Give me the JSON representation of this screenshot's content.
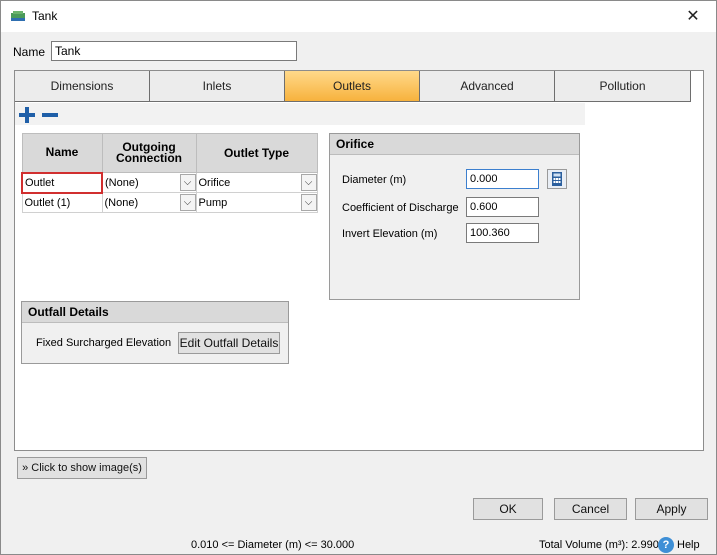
{
  "window": {
    "title": "Tank",
    "close_glyph": "✕",
    "title_icon": "tank-icon"
  },
  "name_field": {
    "label": "Name",
    "value": "Tank"
  },
  "tabs": [
    {
      "label": "Dimensions",
      "active": false
    },
    {
      "label": "Inlets",
      "active": false
    },
    {
      "label": "Outlets",
      "active": true
    },
    {
      "label": "Advanced",
      "active": false
    },
    {
      "label": "Pollution",
      "active": false
    }
  ],
  "toolbar": {
    "add_icon": "plus-icon",
    "remove_icon": "minus-icon"
  },
  "outlets_table": {
    "headers": [
      "Name",
      "Outgoing Connection",
      "Outlet Type"
    ],
    "rows": [
      {
        "name": "Outlet",
        "connection": "(None)",
        "type": "Orifice"
      },
      {
        "name": "Outlet (1)",
        "connection": "(None)",
        "type": "Pump"
      }
    ],
    "dropdown_glyph": "⌵"
  },
  "orifice": {
    "title": "Orifice",
    "diameter_label": "Diameter (m)",
    "diameter_value": "0.000",
    "coef_label": "Coefficient of Discharge",
    "coef_value": "0.600",
    "invert_label": "Invert Elevation (m)",
    "invert_value": "100.360",
    "calc_icon": "calculator-icon"
  },
  "outfall": {
    "title": "Outfall Details",
    "fixed_label": "Fixed Surcharged Elevation",
    "edit_button": "Edit Outfall Details"
  },
  "show_images_button": "Click to show image(s)",
  "buttons": {
    "ok": "OK",
    "cancel": "Cancel",
    "apply": "Apply"
  },
  "status": {
    "constraint": "0.010 <= Diameter (m) <= 30.000",
    "total_volume": "Total Volume (m³): 2.990",
    "help": "Help",
    "help_glyph": "?"
  },
  "colors": {
    "active_tab": "#f7b23d",
    "selected_cell_border": "#d12f2f",
    "icon_blue": "#1f5fa8"
  }
}
